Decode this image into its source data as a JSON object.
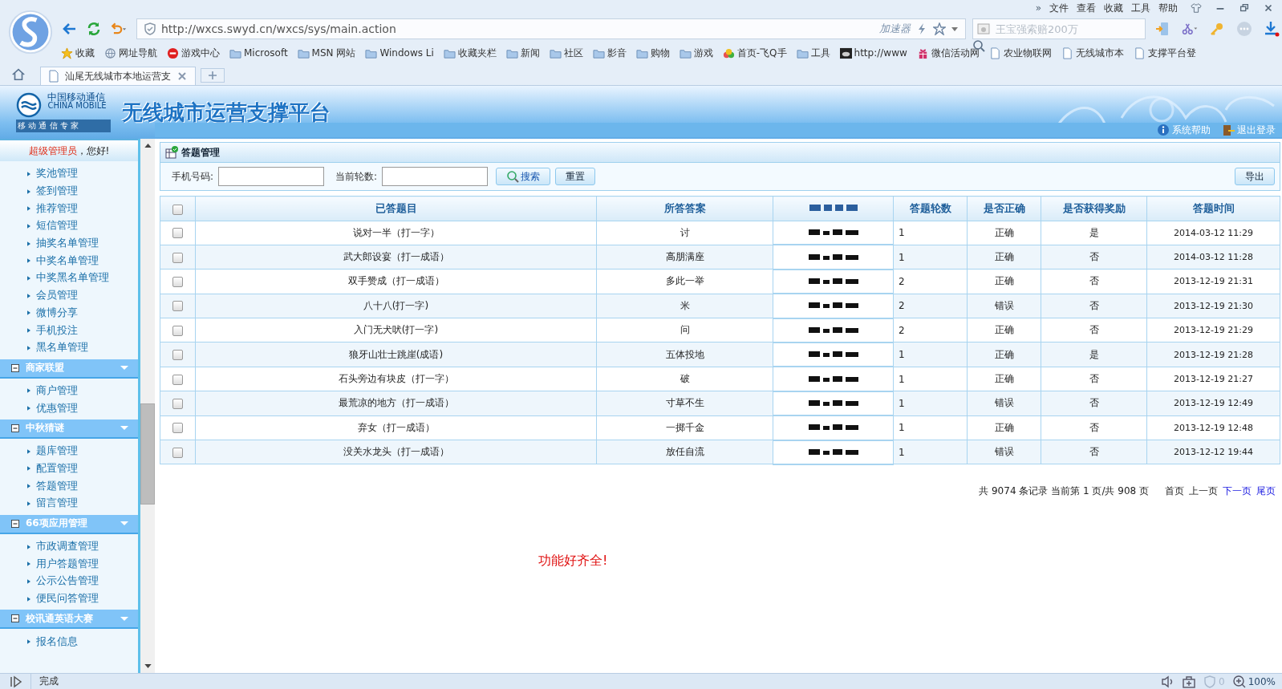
{
  "browser": {
    "more": "»",
    "menu": [
      "文件",
      "查看",
      "收藏",
      "工具",
      "帮助"
    ],
    "address": "http://wxcs.swyd.cn/wxcs/sys/main.action",
    "accelerator": "加速器",
    "search": {
      "placeholder": "王宝强索赔200万"
    },
    "bookmarks": [
      {
        "kind": "star",
        "label": "收藏"
      },
      {
        "kind": "globe",
        "label": "网址导航"
      },
      {
        "kind": "game",
        "label": "游戏中心"
      },
      {
        "kind": "folder",
        "label": "Microsoft"
      },
      {
        "kind": "folder",
        "label": "MSN 网站"
      },
      {
        "kind": "folder",
        "label": "Windows Li"
      },
      {
        "kind": "folder",
        "label": "收藏夹栏"
      },
      {
        "kind": "folder",
        "label": "新闻"
      },
      {
        "kind": "folder",
        "label": "社区"
      },
      {
        "kind": "folder",
        "label": "影音"
      },
      {
        "kind": "folder",
        "label": "购物"
      },
      {
        "kind": "folder",
        "label": "游戏"
      },
      {
        "kind": "app",
        "label": "首页-飞Q手"
      },
      {
        "kind": "folder",
        "label": "工具"
      },
      {
        "kind": "image",
        "label": "http://www"
      },
      {
        "kind": "gift",
        "label": "微信活动网"
      },
      {
        "kind": "page",
        "label": "农业物联网"
      },
      {
        "kind": "page",
        "label": "无线城市本"
      },
      {
        "kind": "page",
        "label": "支撑平台登"
      }
    ],
    "tabs": [
      {
        "title": "汕尾无线城市本地运营支",
        "selected": true
      }
    ],
    "status": "完成",
    "ad_count": "0",
    "zoom": "100%"
  },
  "header": {
    "logo_cn": "中国移动通信",
    "logo_en": "CHINA MOBILE",
    "logo_slogan": "移 动 通 信 专 家",
    "title": "无线城市运营支撑平台",
    "links": [
      {
        "kind": "help",
        "label": "系统帮助"
      },
      {
        "kind": "logout",
        "label": "退出登录"
      }
    ]
  },
  "sidebar": {
    "user": "超级管理员",
    "greeting": "，您好!",
    "groups": [
      {
        "items": [
          "奖池管理",
          "签到管理",
          "推荐管理",
          "短信管理",
          "抽奖名单管理",
          "中奖名单管理",
          "中奖黑名单管理",
          "会员管理",
          "微博分享",
          "手机投注",
          "黑名单管理"
        ]
      },
      {
        "title": "商家联盟",
        "expanded": true,
        "items": [
          "商户管理",
          "优惠管理"
        ]
      },
      {
        "title": "中秋猜谜",
        "expanded": true,
        "items": [
          "题库管理",
          "配置管理",
          "答题管理",
          "留言管理"
        ]
      },
      {
        "title": "66项应用管理",
        "expanded": true,
        "items": [
          "市政调查管理",
          "用户答题管理",
          "公示公告管理",
          "便民问答管理"
        ]
      },
      {
        "title": "校讯通英语大赛",
        "expanded": true,
        "items": [
          "报名信息"
        ]
      }
    ]
  },
  "panel": {
    "title": "答题管理",
    "filters": [
      {
        "label": "手机号码:"
      },
      {
        "label": "当前轮数:"
      }
    ],
    "buttons": [
      {
        "kind": "search",
        "label": "搜索"
      },
      {
        "kind": "reset",
        "label": "重置"
      }
    ],
    "export": "导出",
    "table": {
      "header_checked": false,
      "columns": [
        "已答题目",
        "所答答案",
        "",
        "答题轮数",
        "是否正确",
        "是否获得奖励",
        "答题时间"
      ],
      "rows": [
        {
          "checked": false,
          "question": "说对一半（打一字）",
          "answer": "讨",
          "round": "1",
          "correct": "正确",
          "reward": "是",
          "time": "2014-03-12 11:29"
        },
        {
          "checked": false,
          "question": "武大郎设宴（打一成语）",
          "answer": "高朋满座",
          "round": "1",
          "correct": "正确",
          "reward": "否",
          "time": "2014-03-12 11:28"
        },
        {
          "checked": false,
          "question": "双手赞成（打一成语）",
          "answer": "多此一举",
          "round": "2",
          "correct": "正确",
          "reward": "否",
          "time": "2013-12-19 21:31"
        },
        {
          "checked": false,
          "question": "八十八(打一字)",
          "answer": "米",
          "round": "2",
          "correct": "错误",
          "reward": "否",
          "time": "2013-12-19 21:30"
        },
        {
          "checked": false,
          "question": "入门无犬吠(打一字)",
          "answer": "问",
          "round": "2",
          "correct": "正确",
          "reward": "否",
          "time": "2013-12-19 21:29"
        },
        {
          "checked": false,
          "question": "狼牙山壮士跳崖(成语)",
          "answer": "五体投地",
          "round": "1",
          "correct": "正确",
          "reward": "是",
          "time": "2013-12-19 21:28"
        },
        {
          "checked": false,
          "question": "石头旁边有块皮（打一字）",
          "answer": "破",
          "round": "1",
          "correct": "正确",
          "reward": "否",
          "time": "2013-12-19 21:27"
        },
        {
          "checked": false,
          "question": "最荒凉的地方（打一成语）",
          "answer": "寸草不生",
          "round": "1",
          "correct": "错误",
          "reward": "否",
          "time": "2013-12-19 12:49"
        },
        {
          "checked": false,
          "question": "弃女（打一成语）",
          "answer": "一掷千金",
          "round": "1",
          "correct": "正确",
          "reward": "否",
          "time": "2013-12-19 12:48"
        },
        {
          "checked": false,
          "question": "没关水龙头（打一成语）",
          "answer": "放任自流",
          "round": "1",
          "correct": "错误",
          "reward": "否",
          "time": "2013-12-12 19:44"
        }
      ]
    },
    "pager": {
      "summary": "共 9074 条记录 当前第 1 页/共 908 页",
      "links": [
        {
          "label": "首页",
          "disabled": true
        },
        {
          "label": "上一页",
          "disabled": true
        },
        {
          "label": "下一页",
          "disabled": false
        },
        {
          "label": "尾页",
          "disabled": false
        }
      ]
    },
    "note": "功能好齐全!"
  }
}
